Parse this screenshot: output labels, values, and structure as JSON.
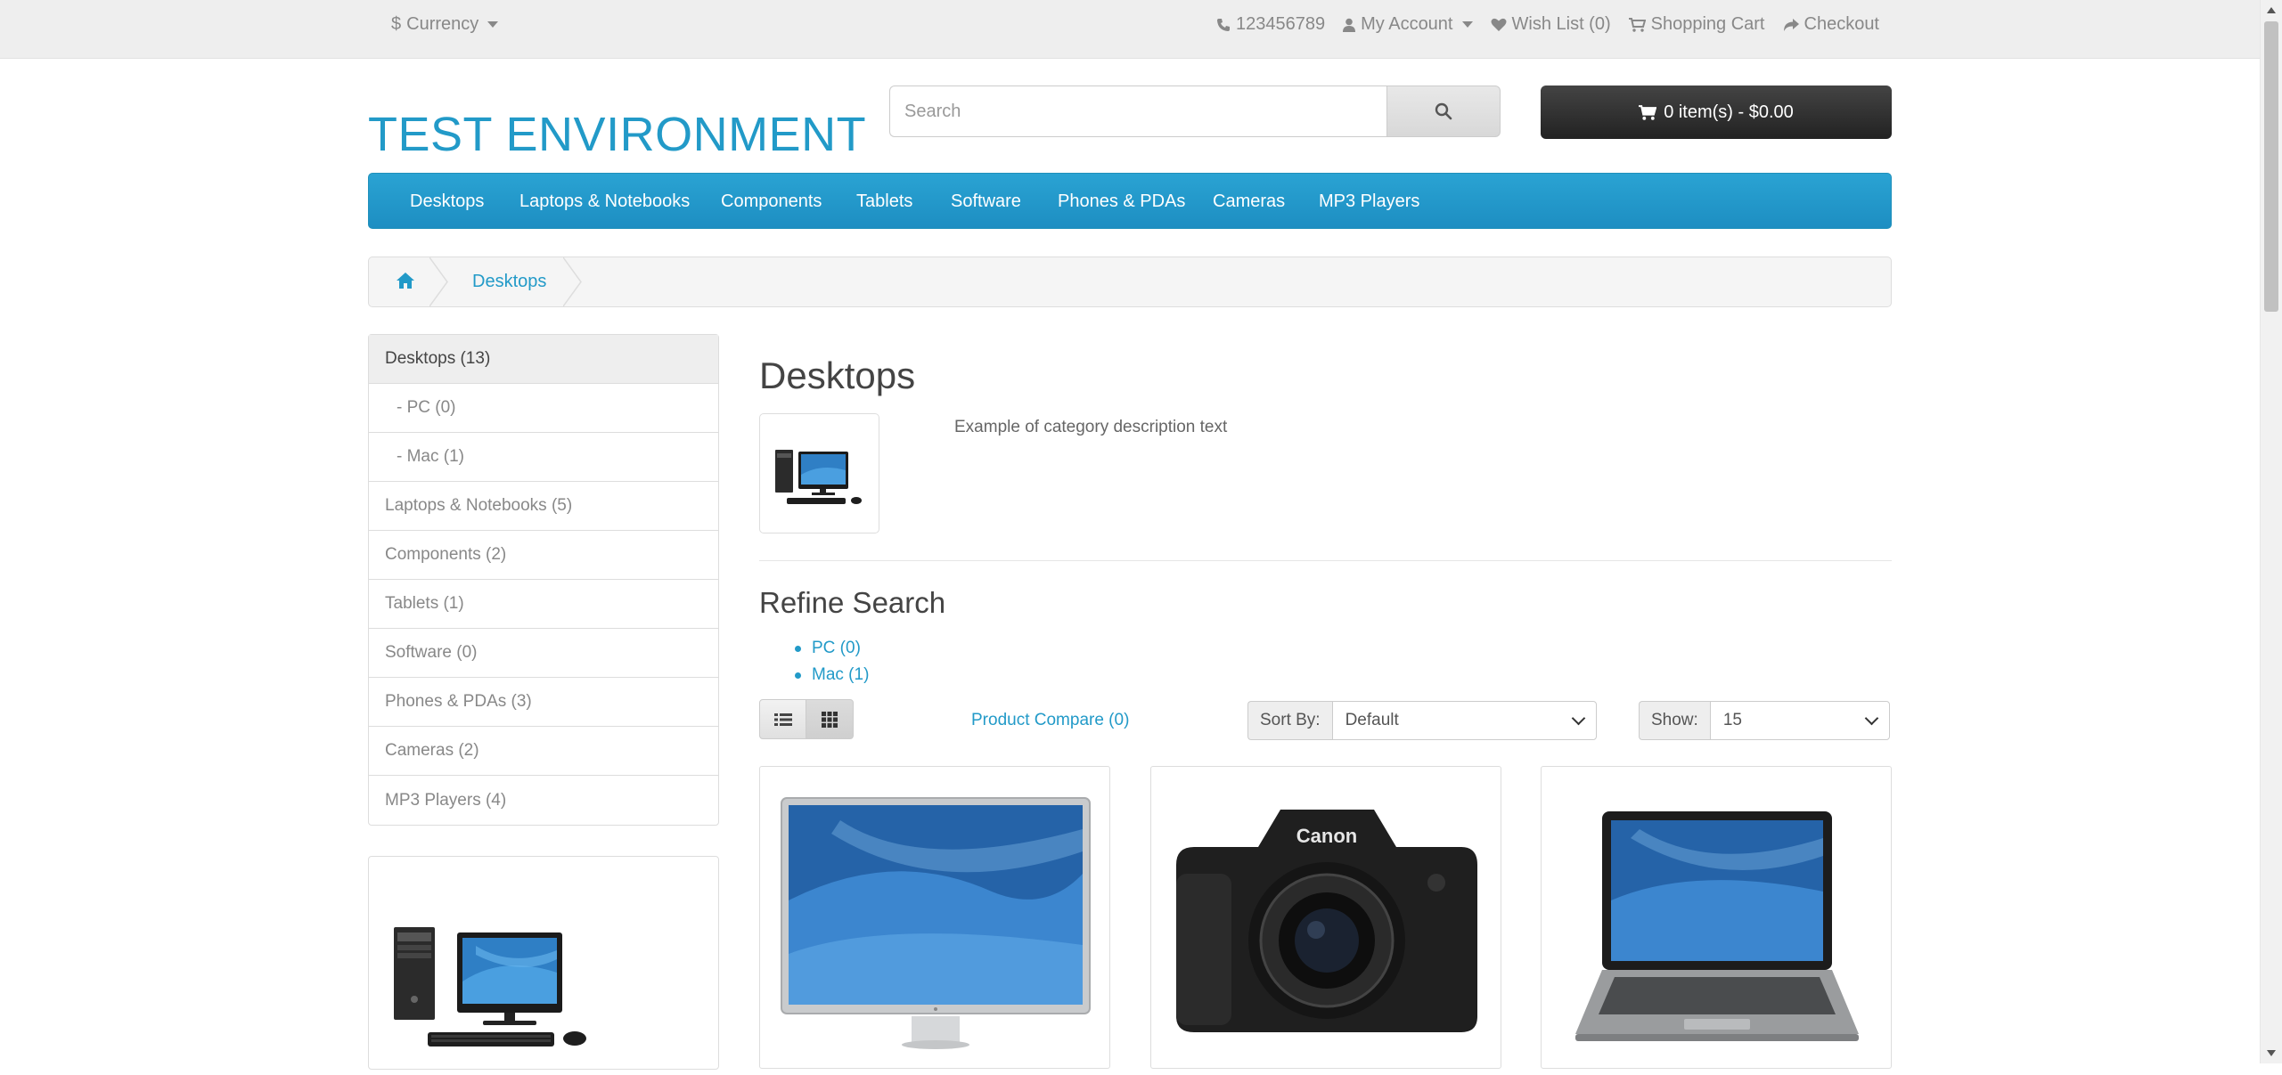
{
  "colors": {
    "accent": "#229ac8",
    "menu": "#229ac8",
    "cart": "#303030"
  },
  "topbar": {
    "currency": {
      "symbol": "$",
      "label": "Currency"
    },
    "phone": "123456789",
    "my_account": "My Account",
    "wishlist": "Wish List (0)",
    "shopping_cart": "Shopping Cart",
    "checkout": "Checkout"
  },
  "header": {
    "logo": "TEST ENVIRONMENT",
    "search_placeholder": "Search",
    "cart_label": "0 item(s) - $0.00"
  },
  "menu": {
    "items": [
      "Desktops",
      "Laptops & Notebooks",
      "Components",
      "Tablets",
      "Software",
      "Phones & PDAs",
      "Cameras",
      "MP3 Players"
    ]
  },
  "breadcrumb": {
    "items": [
      "Desktops"
    ]
  },
  "sidebar": {
    "items": [
      {
        "label": "Desktops (13)"
      },
      {
        "label": "- PC (0)"
      },
      {
        "label": "- Mac (1)"
      },
      {
        "label": "Laptops & Notebooks (5)"
      },
      {
        "label": "Components (2)"
      },
      {
        "label": "Tablets (1)"
      },
      {
        "label": "Software (0)"
      },
      {
        "label": "Phones & PDAs (3)"
      },
      {
        "label": "Cameras (2)"
      },
      {
        "label": "MP3 Players (4)"
      }
    ]
  },
  "content": {
    "title": "Desktops",
    "description": "Example of category description text",
    "refine_title": "Refine Search",
    "refine_links": [
      "PC (0)",
      "Mac (1)"
    ],
    "product_compare": "Product Compare (0)",
    "sort_by_label": "Sort By:",
    "sort_by_value": "Default",
    "show_label": "Show:",
    "show_value": "15"
  },
  "products": [
    {
      "image": "monitor"
    },
    {
      "image": "camera"
    },
    {
      "image": "laptop"
    }
  ]
}
